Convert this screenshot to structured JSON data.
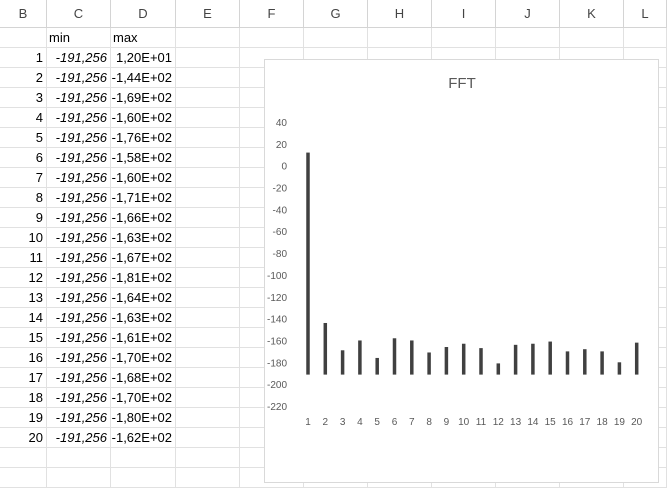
{
  "columns": [
    "B",
    "C",
    "D",
    "E",
    "F",
    "G",
    "H",
    "I",
    "J",
    "K",
    "L"
  ],
  "header_row": {
    "min_label": "min",
    "max_label": "max"
  },
  "rows": [
    {
      "n": "1",
      "min": "-191,256",
      "max": "1,20E+01"
    },
    {
      "n": "2",
      "min": "-191,256",
      "max": "-1,44E+02"
    },
    {
      "n": "3",
      "min": "-191,256",
      "max": "-1,69E+02"
    },
    {
      "n": "4",
      "min": "-191,256",
      "max": "-1,60E+02"
    },
    {
      "n": "5",
      "min": "-191,256",
      "max": "-1,76E+02"
    },
    {
      "n": "6",
      "min": "-191,256",
      "max": "-1,58E+02"
    },
    {
      "n": "7",
      "min": "-191,256",
      "max": "-1,60E+02"
    },
    {
      "n": "8",
      "min": "-191,256",
      "max": "-1,71E+02"
    },
    {
      "n": "9",
      "min": "-191,256",
      "max": "-1,66E+02"
    },
    {
      "n": "10",
      "min": "-191,256",
      "max": "-1,63E+02"
    },
    {
      "n": "11",
      "min": "-191,256",
      "max": "-1,67E+02"
    },
    {
      "n": "12",
      "min": "-191,256",
      "max": "-1,81E+02"
    },
    {
      "n": "13",
      "min": "-191,256",
      "max": "-1,64E+02"
    },
    {
      "n": "14",
      "min": "-191,256",
      "max": "-1,63E+02"
    },
    {
      "n": "15",
      "min": "-191,256",
      "max": "-1,61E+02"
    },
    {
      "n": "16",
      "min": "-191,256",
      "max": "-1,70E+02"
    },
    {
      "n": "17",
      "min": "-191,256",
      "max": "-1,68E+02"
    },
    {
      "n": "18",
      "min": "-191,256",
      "max": "-1,70E+02"
    },
    {
      "n": "19",
      "min": "-191,256",
      "max": "-1,80E+02"
    },
    {
      "n": "20",
      "min": "-191,256",
      "max": "-1,62E+02"
    }
  ],
  "chart_data": {
    "type": "bar",
    "title": "FFT",
    "categories": [
      "1",
      "2",
      "3",
      "4",
      "5",
      "6",
      "7",
      "8",
      "9",
      "10",
      "11",
      "12",
      "13",
      "14",
      "15",
      "16",
      "17",
      "18",
      "19",
      "20"
    ],
    "series": [
      {
        "low": [
          -191.256,
          -191.256,
          -191.256,
          -191.256,
          -191.256,
          -191.256,
          -191.256,
          -191.256,
          -191.256,
          -191.256,
          -191.256,
          -191.256,
          -191.256,
          -191.256,
          -191.256,
          -191.256,
          -191.256,
          -191.256,
          -191.256,
          -191.256
        ],
        "high": [
          12,
          -144,
          -169,
          -160,
          -176,
          -158,
          -160,
          -171,
          -166,
          -163,
          -167,
          -181,
          -164,
          -163,
          -161,
          -170,
          -168,
          -170,
          -180,
          -162
        ]
      }
    ],
    "yticks": [
      "40",
      "20",
      "0",
      "-20",
      "-40",
      "-60",
      "-80",
      "-100",
      "-120",
      "-140",
      "-160",
      "-180",
      "-200",
      "-220"
    ],
    "ylim": [
      -220,
      40
    ],
    "bar_color": "#404040",
    "legend": "none",
    "grid": false
  }
}
